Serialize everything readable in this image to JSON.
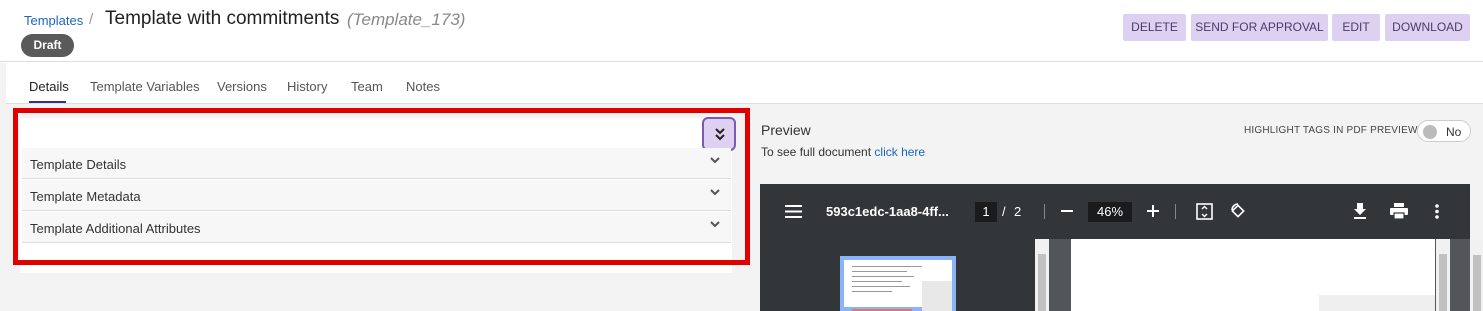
{
  "header": {
    "breadcrumb": "Templates",
    "separator": "/",
    "title": "Template with commitments",
    "subtitle": "(Template_173)",
    "status": "Draft",
    "actions": {
      "delete": "DELETE",
      "send_for_approval": "SEND FOR APPROVAL",
      "edit": "EDIT",
      "download": "DOWNLOAD"
    }
  },
  "tabs": [
    "Details",
    "Template Variables",
    "Versions",
    "History",
    "Team",
    "Notes"
  ],
  "accordion": {
    "items": [
      "Template Details",
      "Template Metadata",
      "Template Additional Attributes"
    ]
  },
  "preview": {
    "title": "Preview",
    "note": "To see full document",
    "link": "click here",
    "highlight_label": "HIGHLIGHT TAGS IN PDF PREVIEW",
    "toggle_value": "No"
  },
  "pdf": {
    "filename": "593c1edc-1aa8-4ff...",
    "current_page": "1",
    "page_sep": "/",
    "total_pages": "2",
    "zoom": "46%"
  },
  "colors": {
    "accent": "#3a2a8a",
    "action_bg": "#ddd0f0",
    "highlight": "#e00000"
  }
}
